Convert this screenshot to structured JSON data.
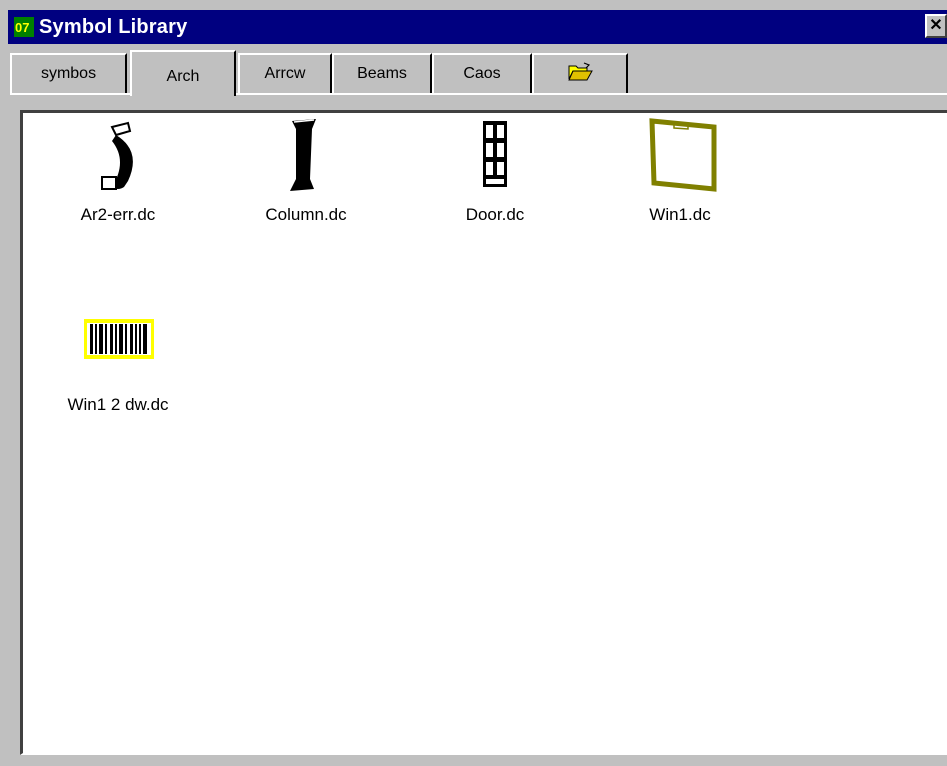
{
  "window": {
    "title": "Symbol Library",
    "close_label": "✕"
  },
  "tabs": [
    {
      "label": "symbos"
    },
    {
      "label": "Arch",
      "active": true
    },
    {
      "label": "Arrcw"
    },
    {
      "label": "Beams"
    },
    {
      "label": "Caos"
    },
    {
      "label": "",
      "icon": "open-folder-icon"
    }
  ],
  "symbols": [
    {
      "label": "Ar2-err.dc",
      "icon": "arch-symbol-icon"
    },
    {
      "label": "Column.dc",
      "icon": "column-symbol-icon"
    },
    {
      "label": "Door.dc",
      "icon": "door-symbol-icon"
    },
    {
      "label": "Win1.dc",
      "icon": "window-symbol-icon"
    },
    {
      "label": "Win1 2 dw.dc",
      "icon": "window-barcode-symbol-icon"
    }
  ],
  "colors": {
    "titlebar": "#000080",
    "window_frame": "#808000",
    "highlight": "#ffff00",
    "face": "#c0c0c0"
  }
}
